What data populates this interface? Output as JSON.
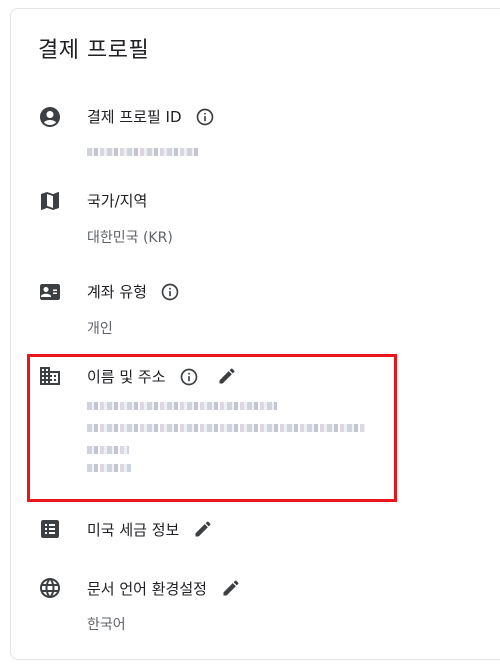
{
  "card": {
    "title": "결제 프로필"
  },
  "rows": {
    "profile_id": {
      "label": "결제 프로필 ID",
      "value": "",
      "icon": "account-circle-icon"
    },
    "country": {
      "label": "국가/지역",
      "value": "대한민국 (KR)",
      "icon": "map-icon"
    },
    "account_type": {
      "label": "계좌 유형",
      "value": "개인",
      "icon": "contact-card-icon"
    },
    "name_address": {
      "label": "이름 및 주소",
      "icon": "building-icon"
    },
    "us_tax": {
      "label": "미국 세금 정보",
      "icon": "list-alt-icon"
    },
    "doc_language": {
      "label": "문서 언어 환경설정",
      "value": "한국어",
      "icon": "globe-icon"
    }
  },
  "colors": {
    "icon": "#3c4043",
    "text": "#202124",
    "secondary_text": "#5f6368",
    "highlight": "#e8161c"
  }
}
